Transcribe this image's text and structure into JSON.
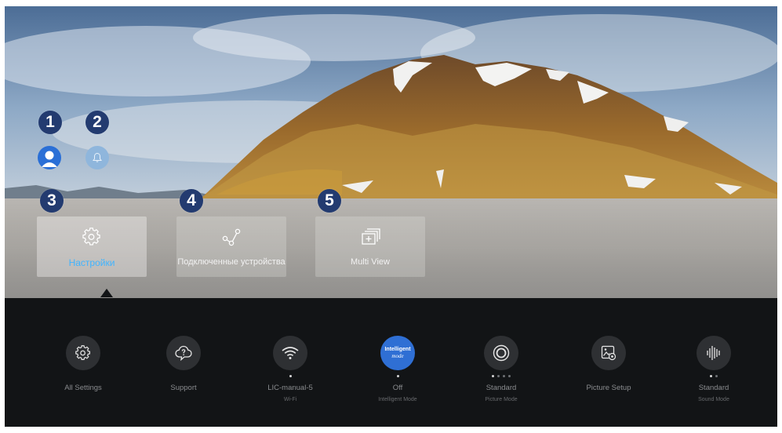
{
  "markers": [
    "1",
    "2",
    "3",
    "4",
    "5"
  ],
  "tiles": [
    {
      "label": "Настройки",
      "icon": "gear-icon"
    },
    {
      "label": "Подключенные устройства",
      "icon": "connected-devices-icon"
    },
    {
      "label": "Multi View",
      "icon": "multi-view-icon"
    }
  ],
  "quick_settings": [
    {
      "label": "All Settings",
      "sub": "",
      "icon": "gear-icon"
    },
    {
      "label": "Support",
      "sub": "",
      "icon": "support-icon"
    },
    {
      "label": "LIC-manual-5",
      "sub": "Wi-Fi",
      "icon": "wifi-icon"
    },
    {
      "label": "Off",
      "sub": "Intelligent Mode",
      "icon": "intelligent-mode-icon",
      "badge_top": "Intelligent",
      "badge_bottom": "mode"
    },
    {
      "label": "Standard",
      "sub": "Picture Mode",
      "icon": "picture-mode-icon"
    },
    {
      "label": "Picture Setup",
      "sub": "",
      "icon": "picture-setup-icon"
    },
    {
      "label": "Standard",
      "sub": "Sound Mode",
      "icon": "sound-mode-icon"
    }
  ],
  "colors": {
    "accent": "#3fb4ff",
    "marker_bg": "#233b70",
    "panel_bg": "#121416",
    "intelligent_bg": "#2f6fd4"
  }
}
